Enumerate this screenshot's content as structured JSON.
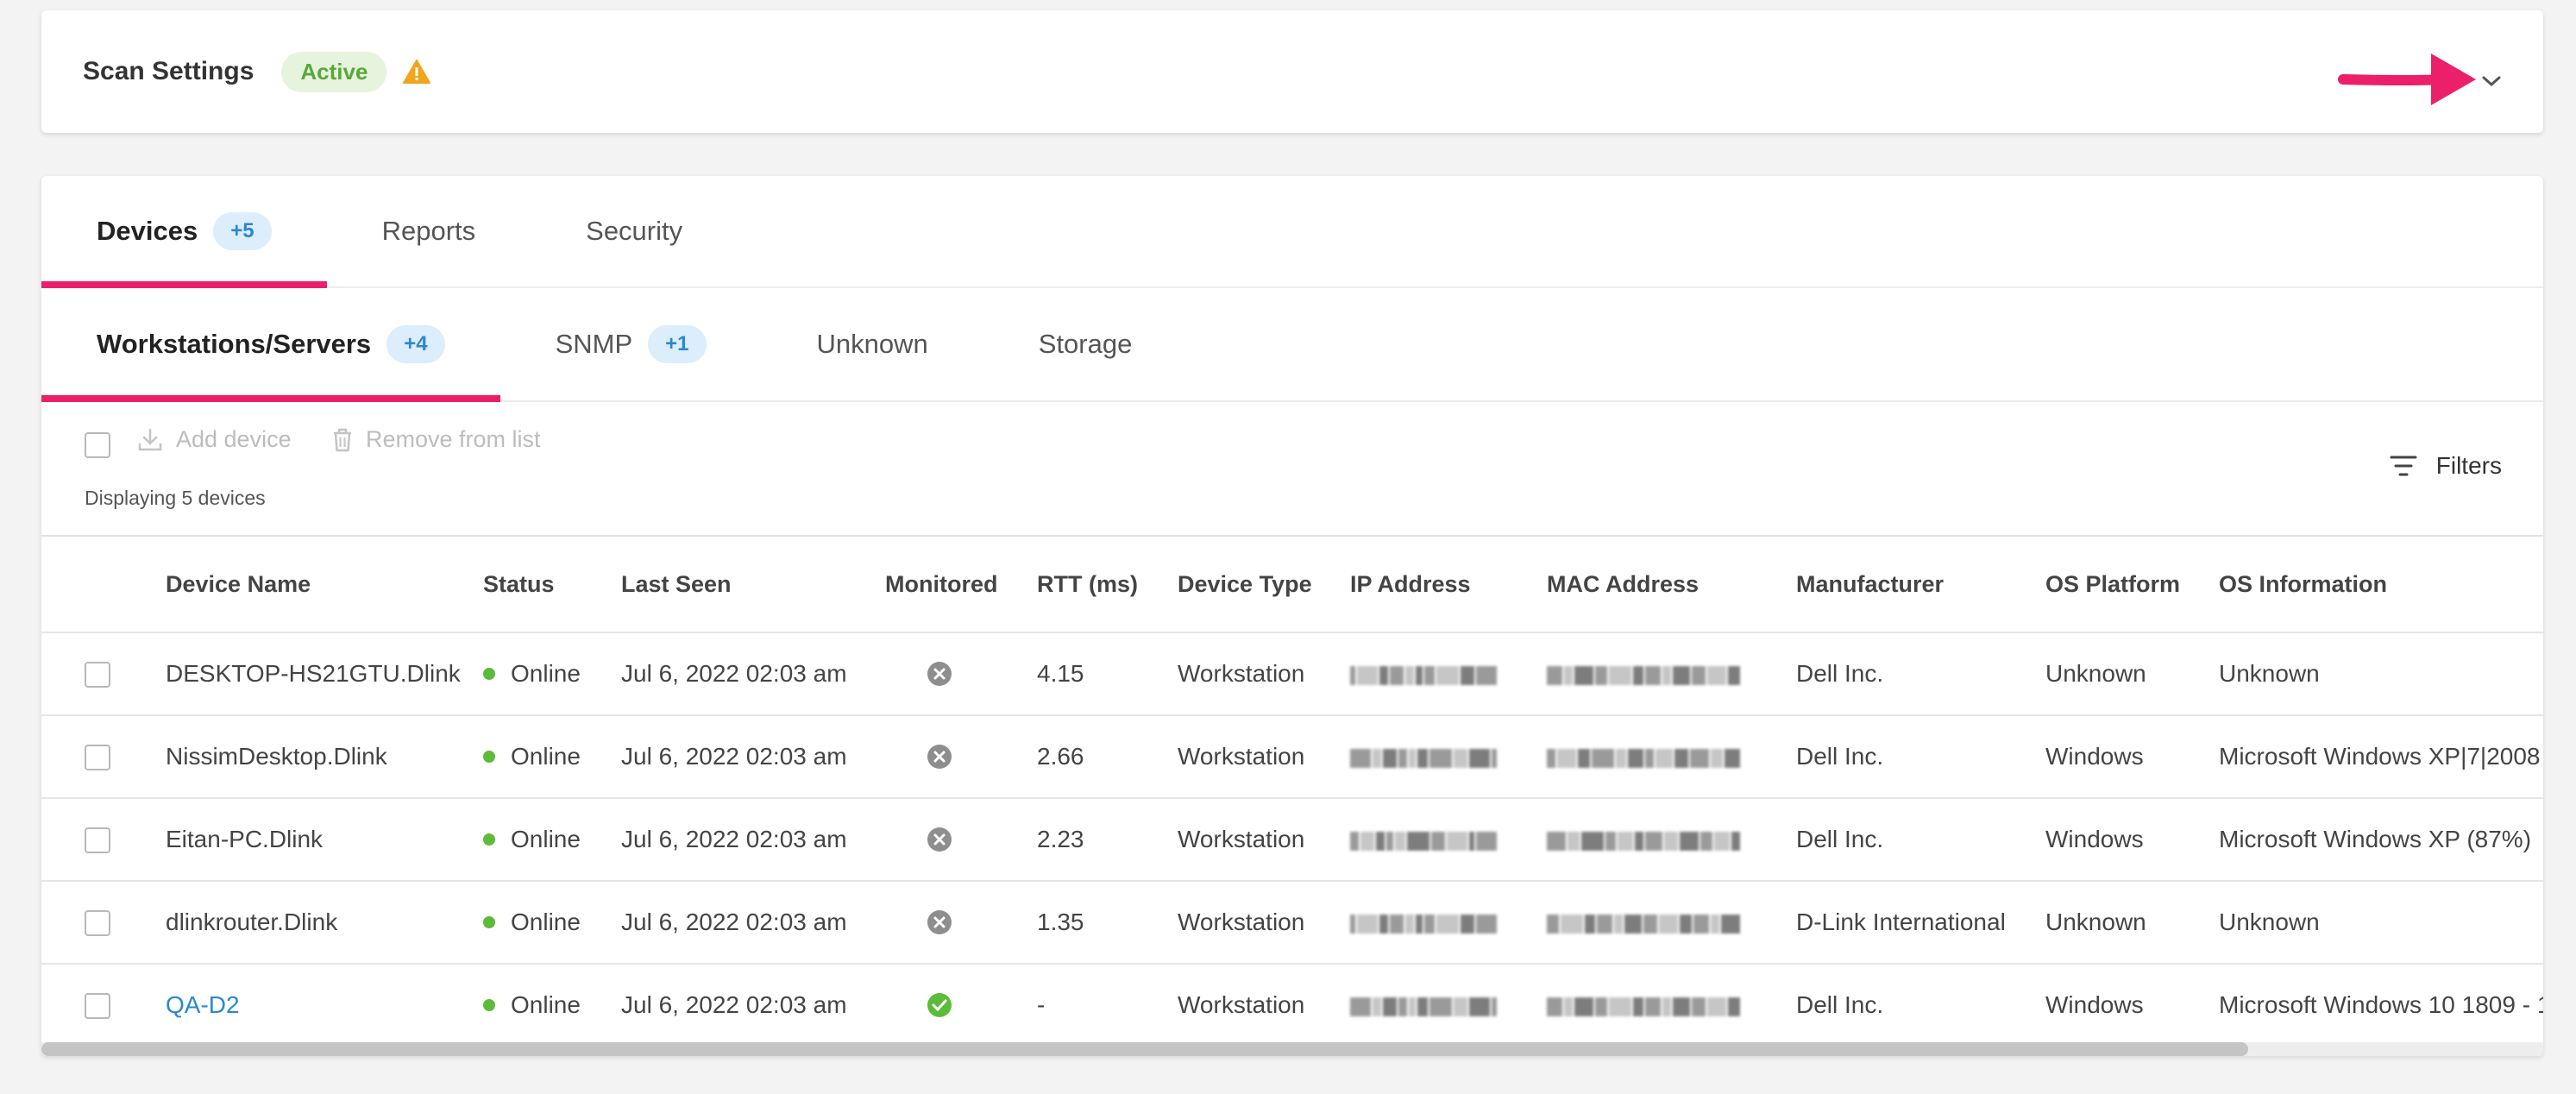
{
  "scan_settings": {
    "title": "Scan Settings",
    "status": "Active",
    "icons": {
      "warning": "warning-triangle-icon",
      "expand": "chevron-down-icon"
    },
    "colors": {
      "active_bg": "#e6f4dd",
      "active_text": "#5aa73b",
      "warning": "#f0a51c",
      "annotation_arrow": "#ec1f6b"
    }
  },
  "primary_tabs": [
    {
      "label": "Devices",
      "badge": "+5",
      "selected": true
    },
    {
      "label": "Reports",
      "badge": "",
      "selected": false
    },
    {
      "label": "Security",
      "badge": "",
      "selected": false
    }
  ],
  "secondary_tabs": [
    {
      "label": "Workstations/Servers",
      "badge": "+4",
      "selected": true
    },
    {
      "label": "SNMP",
      "badge": "+1",
      "selected": false
    },
    {
      "label": "Unknown",
      "badge": "",
      "selected": false
    },
    {
      "label": "Storage",
      "badge": "",
      "selected": false
    }
  ],
  "toolbar": {
    "add_device": "Add device",
    "remove_from_list": "Remove from list",
    "displaying": "Displaying 5 devices",
    "filters": "Filters"
  },
  "table": {
    "headers": {
      "device_name": "Device Name",
      "status": "Status",
      "last_seen": "Last Seen",
      "monitored": "Monitored",
      "rtt": "RTT (ms)",
      "device_type": "Device Type",
      "ip_address": "IP Address",
      "mac_address": "MAC Address",
      "manufacturer": "Manufacturer",
      "os_platform": "OS Platform",
      "os_information": "OS Information"
    },
    "rows": [
      {
        "device_name": "DESKTOP-HS21GTU.Dlink",
        "status": "Online",
        "last_seen": "Jul 6, 2022 02:03 am",
        "monitored": false,
        "rtt": "4.15",
        "device_type": "Workstation",
        "manufacturer": "Dell Inc.",
        "os_platform": "Unknown",
        "os_information": "Unknown",
        "is_link": false
      },
      {
        "device_name": "NissimDesktop.Dlink",
        "status": "Online",
        "last_seen": "Jul 6, 2022 02:03 am",
        "monitored": false,
        "rtt": "2.66",
        "device_type": "Workstation",
        "manufacturer": "Dell Inc.",
        "os_platform": "Windows",
        "os_information": "Microsoft Windows XP|7|2008",
        "is_link": false
      },
      {
        "device_name": "Eitan-PC.Dlink",
        "status": "Online",
        "last_seen": "Jul 6, 2022 02:03 am",
        "monitored": false,
        "rtt": "2.23",
        "device_type": "Workstation",
        "manufacturer": "Dell Inc.",
        "os_platform": "Windows",
        "os_information": "Microsoft Windows XP (87%)",
        "is_link": false
      },
      {
        "device_name": "dlinkrouter.Dlink",
        "status": "Online",
        "last_seen": "Jul 6, 2022 02:03 am",
        "monitored": false,
        "rtt": "1.35",
        "device_type": "Workstation",
        "manufacturer": "D-Link International",
        "os_platform": "Unknown",
        "os_information": "Unknown",
        "is_link": false
      },
      {
        "device_name": "QA-D2",
        "status": "Online",
        "last_seen": "Jul 6, 2022 02:03 am",
        "monitored": true,
        "rtt": "-",
        "device_type": "Workstation",
        "manufacturer": "Dell Inc.",
        "os_platform": "Windows",
        "os_information": "Microsoft Windows 10 1809 - 1",
        "is_link": true
      }
    ]
  },
  "colors": {
    "tab_indicator": "#ec1f6b",
    "badge_bg": "#dcedfb",
    "badge_text": "#2a88cf",
    "online_dot": "#5dbb3a",
    "monitored_true": "#5dbb3a",
    "monitored_false": "#8e8e8e",
    "link": "#2a88cf"
  },
  "scrollbar": {
    "horizontal_position": 0.88
  }
}
